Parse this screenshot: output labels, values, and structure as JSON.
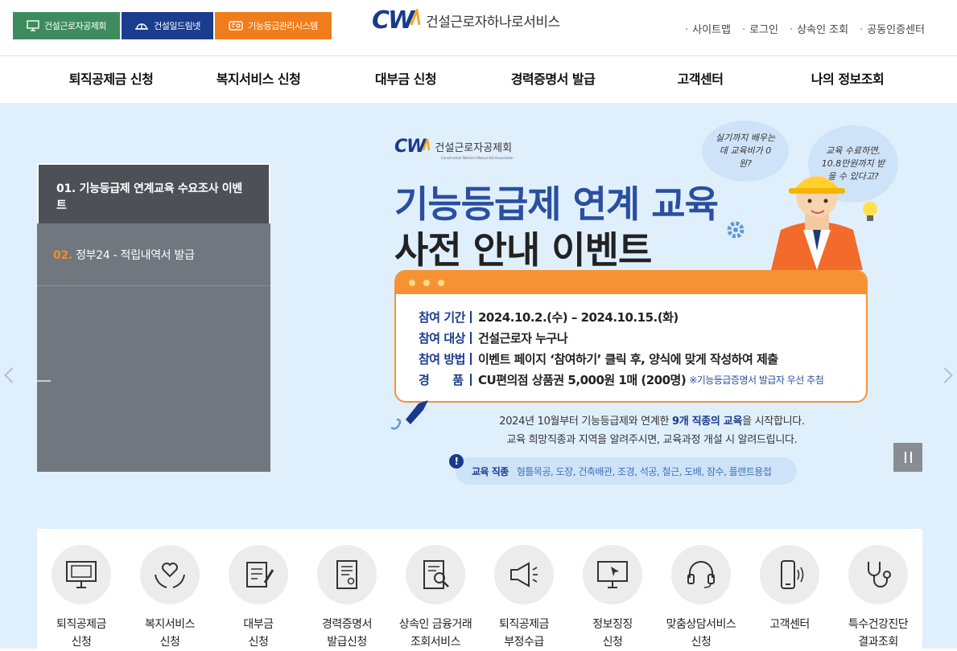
{
  "header": {
    "family_sites": [
      {
        "label": "건설근로자공제회",
        "color": "#3d8c5e",
        "icon": "monitor-icon"
      },
      {
        "label": "건설일드림넷",
        "color": "#1b3d8e",
        "icon": "helmet-icon"
      },
      {
        "label": "기능등급관리시스템",
        "color": "#f07d1c",
        "icon": "certificate-icon"
      }
    ],
    "logo": {
      "wordmark": "CW",
      "name": "건설근로자하나로서비스"
    },
    "util_links": [
      "사이트맵",
      "로그인",
      "상속인 조회",
      "공동인증센터"
    ]
  },
  "gnb": [
    "퇴직공제금 신청",
    "복지서비스 신청",
    "대부금 신청",
    "경력증명서 발급",
    "고객센터",
    "나의 정보조회"
  ],
  "slider": {
    "tabs": [
      {
        "num": "01.",
        "label": "기능등급제 연계교육 수요조사 이벤트"
      },
      {
        "num": "02.",
        "label": "정부24 - 적립내역서 발급"
      }
    ],
    "banner": {
      "org_wordmark": "CW",
      "org_name": "건설근로자공제회",
      "org_sub": "Construction Workers Mutual Aid Association",
      "title_1": "기능등급제 연계 교육",
      "title_2": "사전 안내 이벤트",
      "bubble_1": "실기까지 배우는데 교육비가 0원?",
      "bubble_2": "교육 수료하면, 10.8만원까지 받을 수 있다고?",
      "rows": [
        {
          "key": "참여 기간",
          "value": "2024.10.2.(수) – 2024.10.15.(화)",
          "note": ""
        },
        {
          "key": "참여 대상",
          "value": "건설근로자 누구나",
          "note": ""
        },
        {
          "key": "참여 방법",
          "value": "이벤트 페이지 ‘참여하기’ 클릭 후, 양식에 맞게 작성하여 제출",
          "note": ""
        },
        {
          "key": "경　　품",
          "value": "CU편의점 상품권 5,000원 1매 (200명)",
          "note": "※기능등급증명서 발급자 우선 추첨"
        }
      ],
      "desc_1a": "2024년 10월부터 기능등급제와 연계한 ",
      "desc_1b": "9개 직종의 교육",
      "desc_1c": "을 시작합니다.",
      "desc_2": "교육 희망직종과 지역을 알려주시면, 교육과정 개설 시 알려드립니다.",
      "jobs_label": "교육 직종",
      "jobs": "형틀목공, 도장, 건축배관, 조경, 석공, 철근, 도배, 잠수, 플랜트용접"
    }
  },
  "quick_menu": [
    {
      "label": "퇴직공제금\n신청",
      "icon": "computer-icon"
    },
    {
      "label": "복지서비스\n신청",
      "icon": "heart-hands-icon"
    },
    {
      "label": "대부금\n신청",
      "icon": "clipboard-pen-icon"
    },
    {
      "label": "경력증명서\n발급신청",
      "icon": "certificate-document-icon"
    },
    {
      "label": "상속인 금융거래\n조회서비스",
      "icon": "document-search-icon"
    },
    {
      "label": "퇴직공제금\n부정수급",
      "icon": "megaphone-icon"
    },
    {
      "label": "정보징징\n신청",
      "icon": "monitor-cursor-icon"
    },
    {
      "label": "맞춤상담서비스\n신청",
      "icon": "headset-icon"
    },
    {
      "label": "고객센터",
      "icon": "smartphone-icon"
    },
    {
      "label": "특수건강진단\n결과조회",
      "icon": "stethoscope-icon"
    }
  ]
}
